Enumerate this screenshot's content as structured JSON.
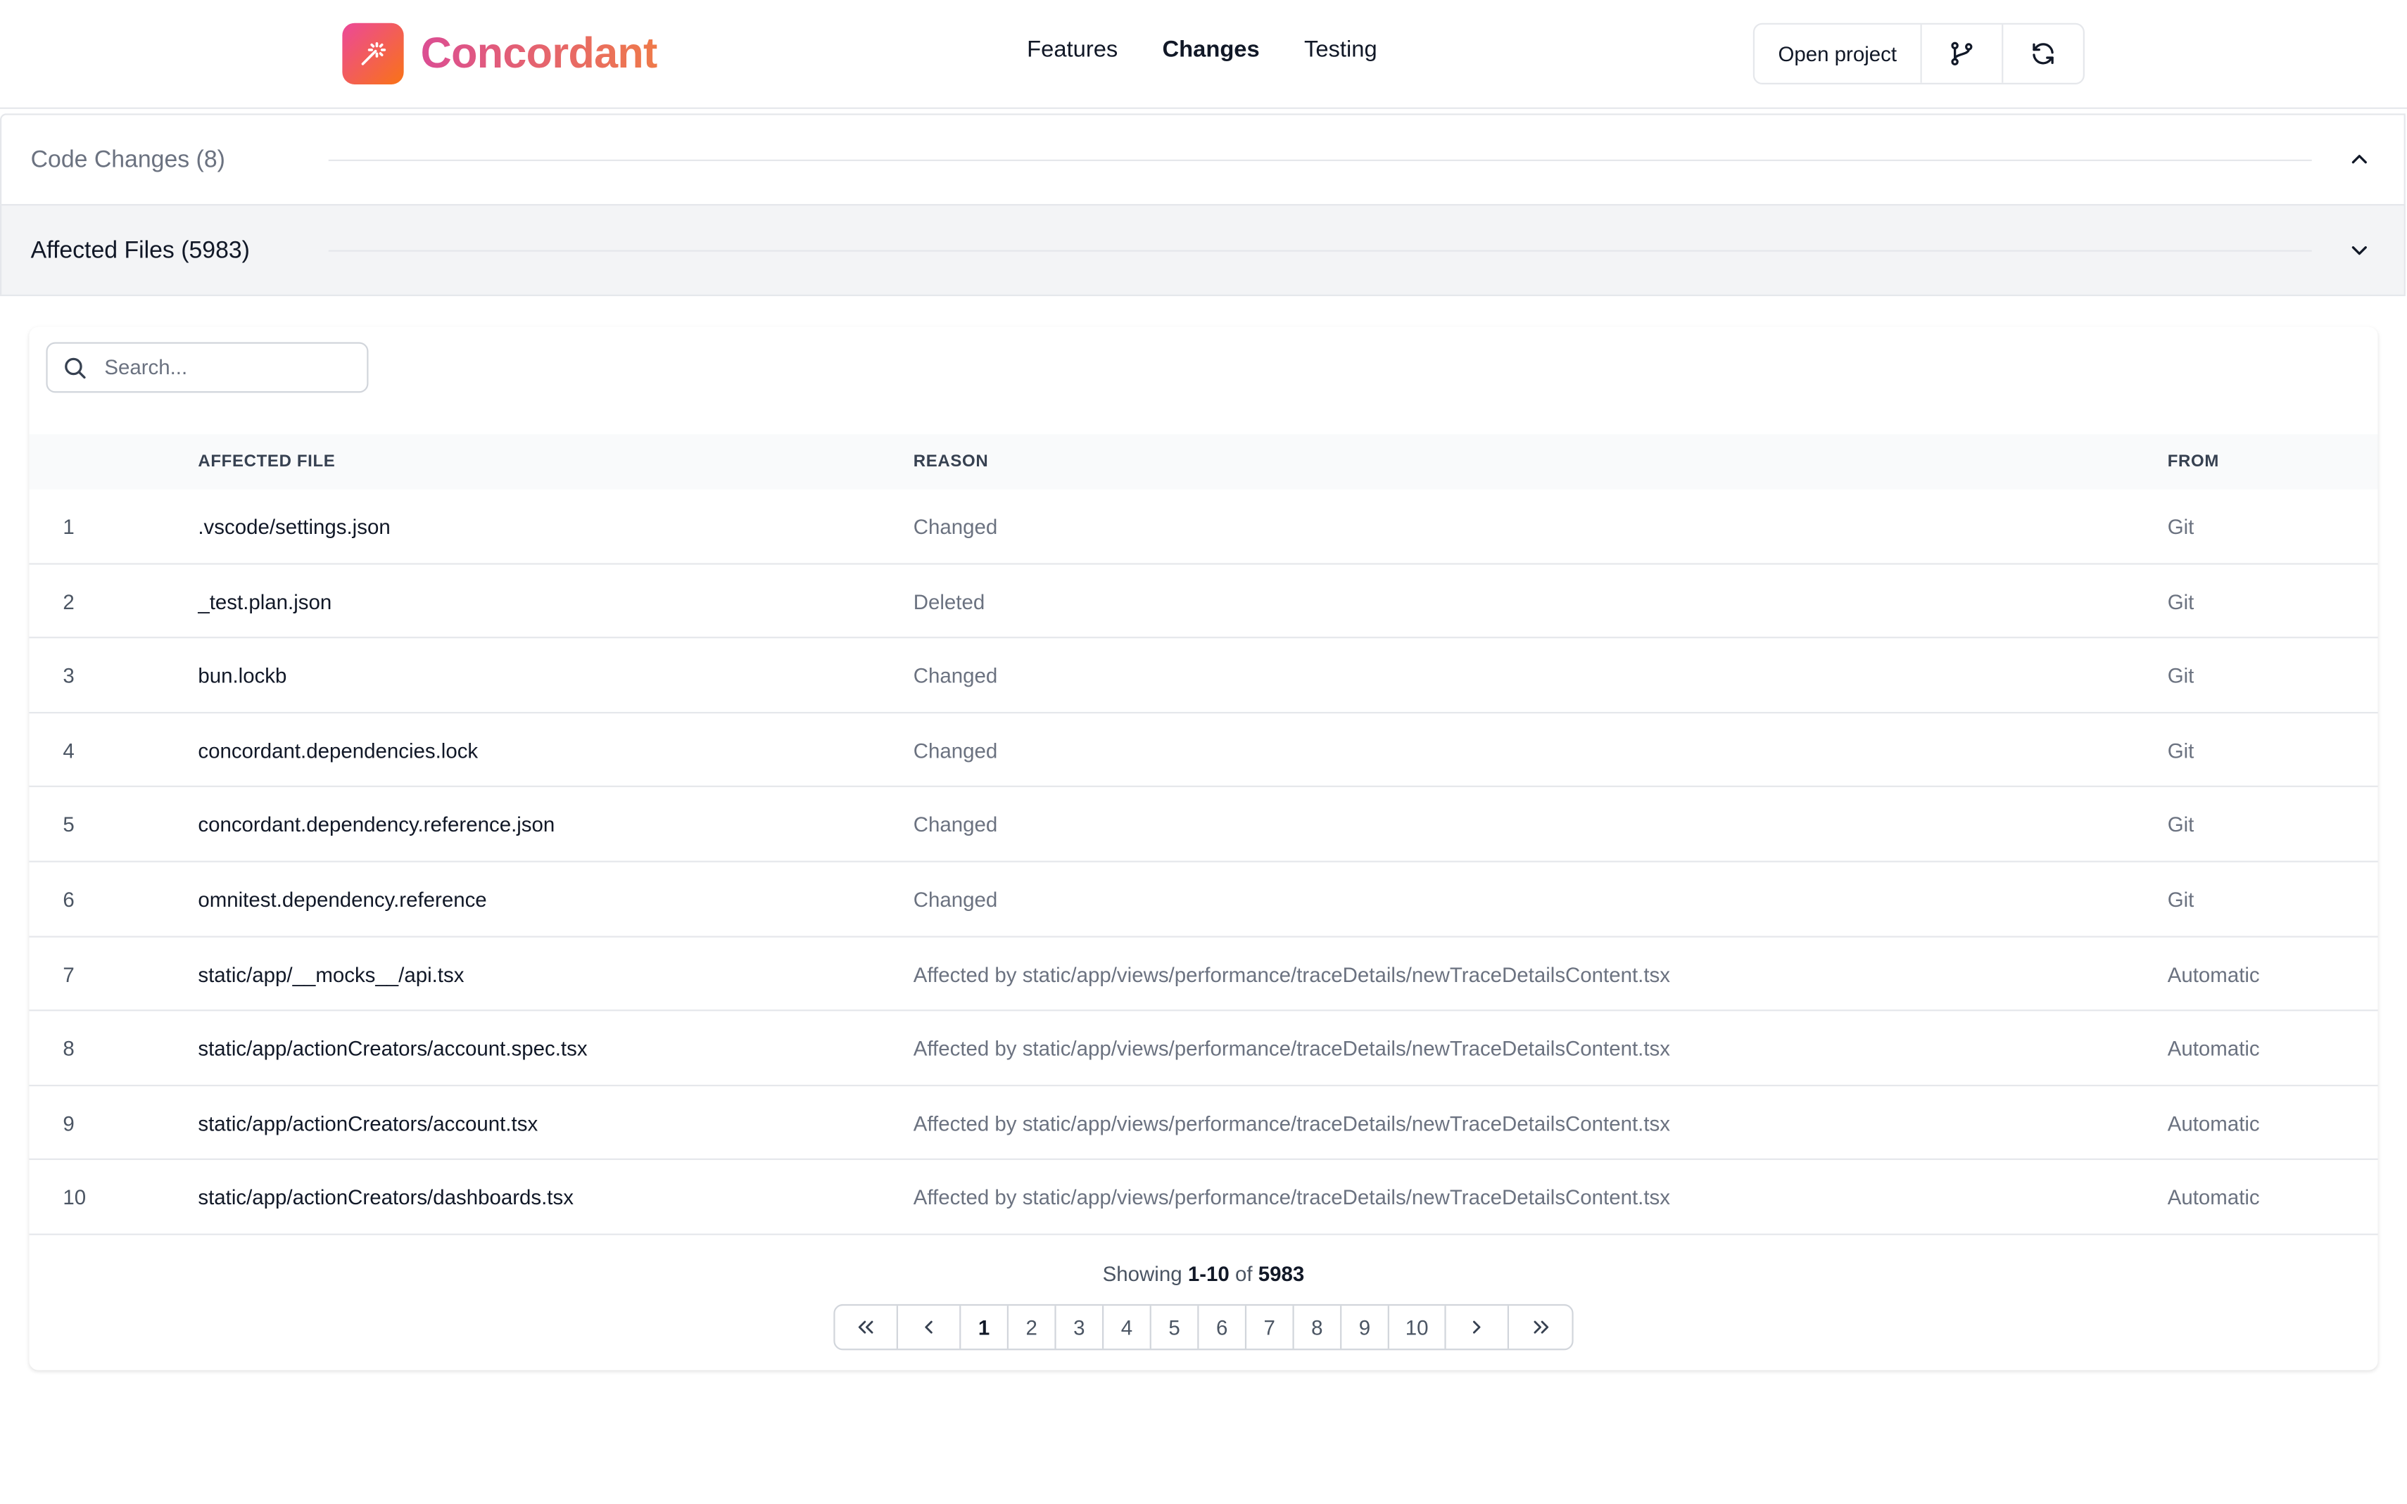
{
  "header": {
    "brand": "Concordant",
    "nav": [
      {
        "label": "Features",
        "active": false
      },
      {
        "label": "Changes",
        "active": true
      },
      {
        "label": "Testing",
        "active": false
      }
    ],
    "open_project_label": "Open project",
    "branch_icon": "git-branch-icon",
    "refresh_icon": "refresh-icon"
  },
  "sections": {
    "code_changes": {
      "title": "Code Changes (8)",
      "expanded": false
    },
    "affected_files": {
      "title": "Affected Files (5983)",
      "expanded": true
    }
  },
  "search": {
    "placeholder": "Search...",
    "value": ""
  },
  "table": {
    "columns": [
      "",
      "AFFECTED FILE",
      "REASON",
      "FROM"
    ],
    "rows": [
      {
        "idx": "1",
        "file": ".vscode/settings.json",
        "reason": "Changed",
        "from": "Git"
      },
      {
        "idx": "2",
        "file": "_test.plan.json",
        "reason": "Deleted",
        "from": "Git"
      },
      {
        "idx": "3",
        "file": "bun.lockb",
        "reason": "Changed",
        "from": "Git"
      },
      {
        "idx": "4",
        "file": "concordant.dependencies.lock",
        "reason": "Changed",
        "from": "Git"
      },
      {
        "idx": "5",
        "file": "concordant.dependency.reference.json",
        "reason": "Changed",
        "from": "Git"
      },
      {
        "idx": "6",
        "file": "omnitest.dependency.reference",
        "reason": "Changed",
        "from": "Git"
      },
      {
        "idx": "7",
        "file": "static/app/__mocks__/api.tsx",
        "reason": "Affected by static/app/views/performance/traceDetails/newTraceDetailsContent.tsx",
        "from": "Automatic"
      },
      {
        "idx": "8",
        "file": "static/app/actionCreators/account.spec.tsx",
        "reason": "Affected by static/app/views/performance/traceDetails/newTraceDetailsContent.tsx",
        "from": "Automatic"
      },
      {
        "idx": "9",
        "file": "static/app/actionCreators/account.tsx",
        "reason": "Affected by static/app/views/performance/traceDetails/newTraceDetailsContent.tsx",
        "from": "Automatic"
      },
      {
        "idx": "10",
        "file": "static/app/actionCreators/dashboards.tsx",
        "reason": "Affected by static/app/views/performance/traceDetails/newTraceDetailsContent.tsx",
        "from": "Automatic"
      }
    ]
  },
  "pagination": {
    "showing_prefix": "Showing",
    "range": "1-10",
    "of": "of",
    "total": "5983",
    "pages": [
      "1",
      "2",
      "3",
      "4",
      "5",
      "6",
      "7",
      "8",
      "9",
      "10"
    ],
    "current_page": "1"
  },
  "colors": {
    "brand_start": "#ec4899",
    "brand_end": "#f97316",
    "border": "#e5e7eb",
    "muted_text": "#6b7280"
  }
}
